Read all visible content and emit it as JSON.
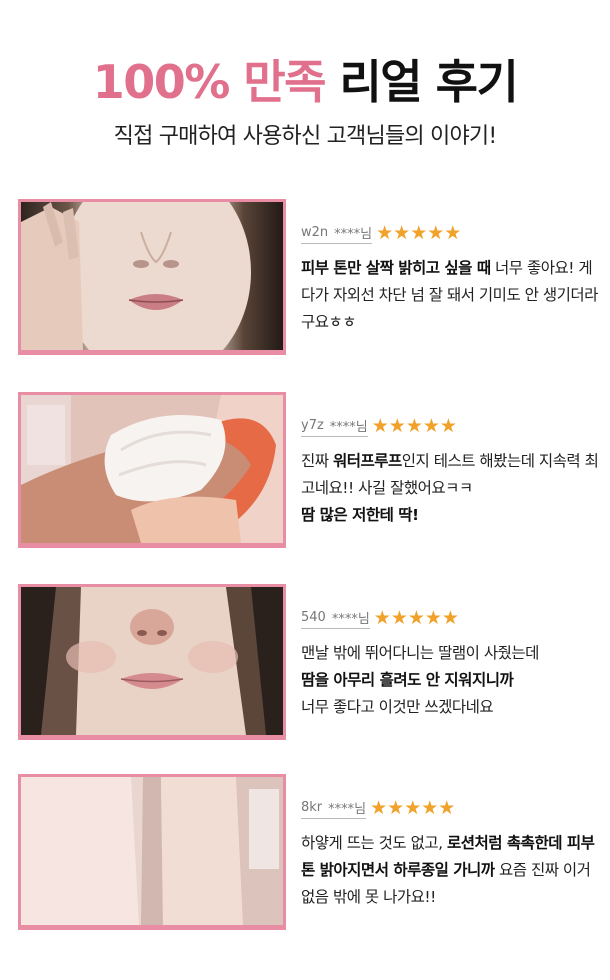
{
  "header": {
    "title_accent": "100% 만족",
    "title_rest": "리얼 후기",
    "subtitle": "직접 구매하여 사용하신 고객님들의 이야기!"
  },
  "reviews": [
    {
      "user": "w2n",
      "mask": "****님",
      "stars": "★★★★★",
      "rating": 5,
      "photo": "face-closeup-cheek-hand",
      "p1_bold": "피부 톤만 살짝 밝히고 싶을 때",
      "p1_rest": " 너무 좋아요! 게다가 자외선 차단 넘 잘 돼서 기미도 안 생기더라구요ㅎㅎ"
    },
    {
      "user": "y7z",
      "mask": "****님",
      "stars": "★★★★★",
      "rating": 5,
      "photo": "cream-swatch-on-hand",
      "p1_pre": "진짜 ",
      "p1_bold": "워터프루프",
      "p1_rest": "인지 테스트 해봤는데 지속력 최고네요!! 사길 잘했어요ㅋㅋ",
      "p2_bold": "땀 많은 저한테 딱!"
    },
    {
      "user": "540",
      "mask": "****님",
      "stars": "★★★★★",
      "rating": 5,
      "photo": "face-closeup-nose-lips",
      "p1_rest": "맨날 밖에 뛰어다니는 딸램이 사줬는데",
      "p2_bold": "땀을 아무리 흘려도 안 지워지니까",
      "p3_rest": "너무 좋다고 이것만 쓰겠다네요"
    },
    {
      "user": "8kr",
      "mask": "****님",
      "stars": "★★★★★",
      "rating": 5,
      "photo": "forearm-skin-comparison",
      "p1_pre": "하얗게 뜨는 것도 없고, ",
      "p1_bold": "로션처럼 촉촉한데 피부톤 밝아지면서 하루종일 가니까",
      "p1_rest": " 요즘 진짜 이거 없음 밖에 못 나가요!!"
    }
  ],
  "colors": {
    "accent": "#e0708c",
    "frame": "#e88da3",
    "star": "#f0a22a"
  }
}
